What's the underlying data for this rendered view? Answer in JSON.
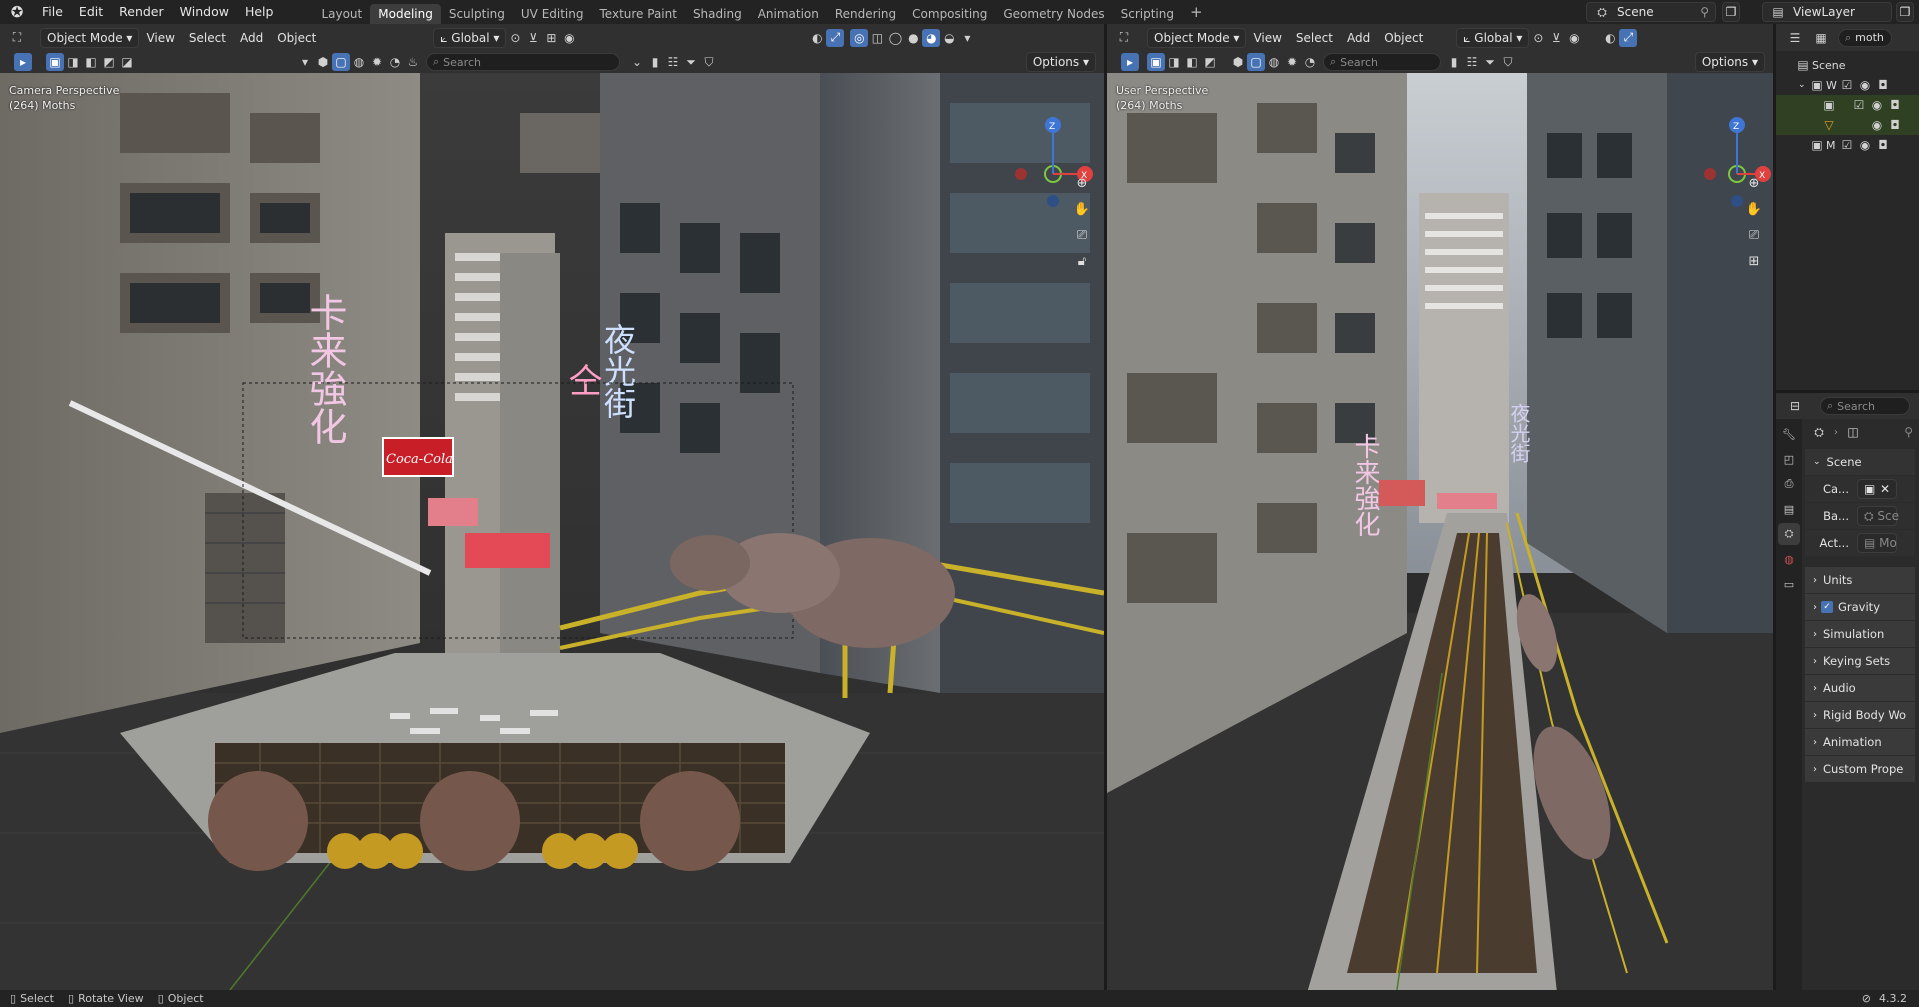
{
  "menu": {
    "items": [
      "File",
      "Edit",
      "Render",
      "Window",
      "Help"
    ]
  },
  "workspaces": {
    "tabs": [
      "Layout",
      "Modeling",
      "Sculpting",
      "UV Editing",
      "Texture Paint",
      "Shading",
      "Animation",
      "Rendering",
      "Compositing",
      "Geometry Nodes",
      "Scripting"
    ],
    "active": "Modeling",
    "add_label": "+"
  },
  "topright": {
    "scene": "Scene",
    "view_layer": "ViewLayer"
  },
  "left_viewport": {
    "mode": "Object Mode",
    "menus": [
      "View",
      "Select",
      "Add",
      "Object"
    ],
    "orientation": "Global",
    "search_placeholder": "Search",
    "options_label": "Options",
    "label_line1": "Camera Perspective",
    "label_line2": "(264) Moths"
  },
  "right_viewport": {
    "mode": "Object Mode",
    "menus": [
      "View",
      "Select",
      "Add",
      "Object"
    ],
    "orientation": "Global",
    "search_placeholder": "Search",
    "options_label": "Options",
    "label_line1": "User Perspective",
    "label_line2": "(264) Moths"
  },
  "gizmo": {
    "z": "Z",
    "y": "Y",
    "x": "X"
  },
  "signs": {
    "neon1": "卡来強化",
    "neon2": "夜光街",
    "neon3": "仝",
    "cola": "Coca-Cola"
  },
  "outliner": {
    "search_placeholder": "moth",
    "scene": "Scene",
    "items": [
      "W",
      "",
      "",
      "M"
    ]
  },
  "properties": {
    "search_placeholder": "Search",
    "scene_header": "Scene",
    "rows": [
      {
        "label": "Ca...",
        "value": ""
      },
      {
        "label": "Ba...",
        "value": "Sce"
      },
      {
        "label": "Act...",
        "value": "Mo"
      }
    ],
    "panels": [
      "Units",
      "Gravity",
      "Simulation",
      "Keying Sets",
      "Audio",
      "Rigid Body Wo",
      "Custom Prope"
    ],
    "gravity_checked": true
  },
  "status": {
    "select": "Select",
    "rotate": "Rotate View",
    "object": "Object",
    "version": "4.3.2"
  },
  "colors": {
    "accent": "#4772b3",
    "bg": "#2e2e2e",
    "axis_x": "#e0413f",
    "axis_y": "#7ec83e",
    "axis_z": "#3f76d6"
  }
}
